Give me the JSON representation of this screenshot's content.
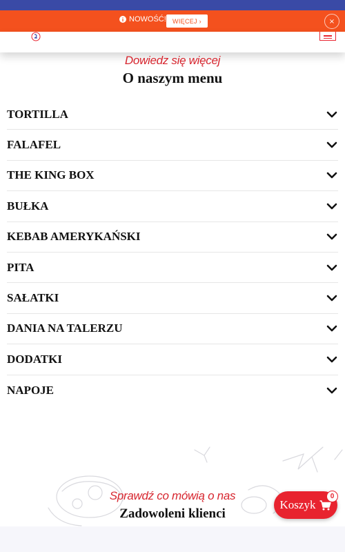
{
  "notice": {
    "label": "NOWOŚĆ!",
    "more_button": "WIĘCEJ ›",
    "close": "×"
  },
  "header": {
    "logo_icon": "logo-icon",
    "menu_icon": "hamburger-menu-icon"
  },
  "menu_section": {
    "eyebrow": "Dowiedz się więcej",
    "title": "O naszym menu",
    "items": [
      {
        "label": "TORTILLA"
      },
      {
        "label": "FALAFEL"
      },
      {
        "label": "THE KING BOX"
      },
      {
        "label": "BUŁKA"
      },
      {
        "label": "KEBAB AMERYKAŃSKI"
      },
      {
        "label": "PITA"
      },
      {
        "label": "SAŁATKI"
      },
      {
        "label": "DANIA NA TALERZU"
      },
      {
        "label": "DODATKI"
      },
      {
        "label": "NAPOJE"
      }
    ]
  },
  "reviews_section": {
    "eyebrow": "Sprawdź co mówią o nas",
    "title": "Zadowoleni klienci"
  },
  "cart": {
    "label": "Koszyk",
    "count": "0",
    "icon": "cart-icon"
  },
  "colors": {
    "accent_red": "#e8232f",
    "notice_orange": "#f4511e",
    "top_blue": "#3a4aa6"
  }
}
